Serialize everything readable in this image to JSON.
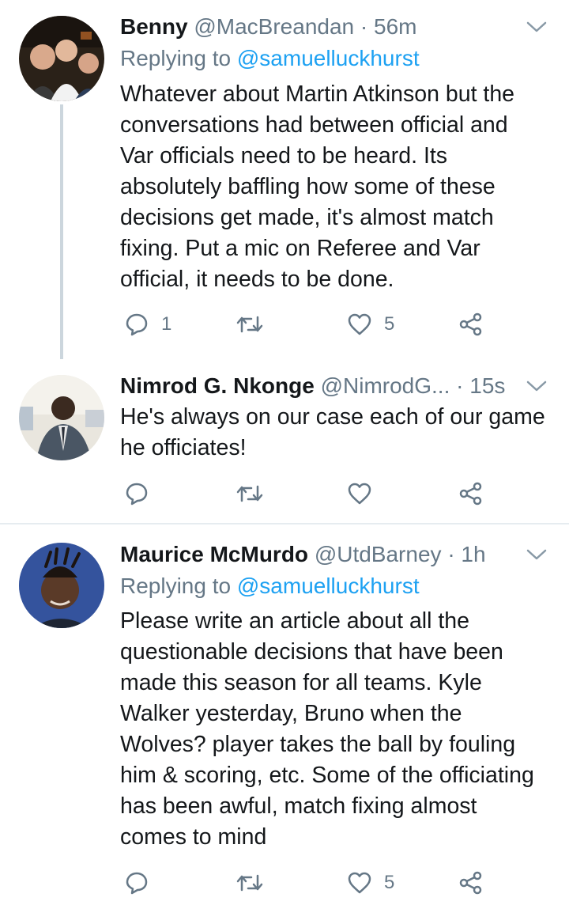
{
  "tweets": [
    {
      "name": "Benny",
      "handle": "@MacBreandan",
      "sep": "·",
      "time": "56m",
      "replying_label": "Replying to",
      "replying_to": "@samuelluckhurst",
      "text": "Whatever about Martin Atkinson but the conversations had between official and Var officials need to be heard. Its absolutely baffling how some of these decisions get made, it's almost match fixing. Put a mic on Referee and Var official, it needs to be done.",
      "reply_count": "1",
      "retweet_count": "",
      "like_count": "5"
    },
    {
      "name": "Nimrod G. Nkonge",
      "handle": "@NimrodG...",
      "sep": "·",
      "time": "15s",
      "text": "He's always on our case each of our game he officiates!",
      "reply_count": "",
      "retweet_count": "",
      "like_count": ""
    },
    {
      "name": "Maurice McMurdo",
      "handle": "@UtdBarney",
      "sep": "·",
      "time": "1h",
      "replying_label": "Replying to",
      "replying_to": "@samuelluckhurst",
      "text": "Please write an article about all the questionable decisions that have been made this season for all teams. Kyle Walker yesterday, Bruno when the Wolves? player takes the ball by fouling him & scoring, etc. Some of the officiating has been awful, match fixing almost comes to mind",
      "reply_count": "",
      "retweet_count": "",
      "like_count": "5"
    }
  ],
  "colors": {
    "text": "#14171a",
    "secondary": "#657786",
    "link": "#1da1f2",
    "thread_line": "#ccd6dd",
    "divider": "#e6ecf0"
  }
}
